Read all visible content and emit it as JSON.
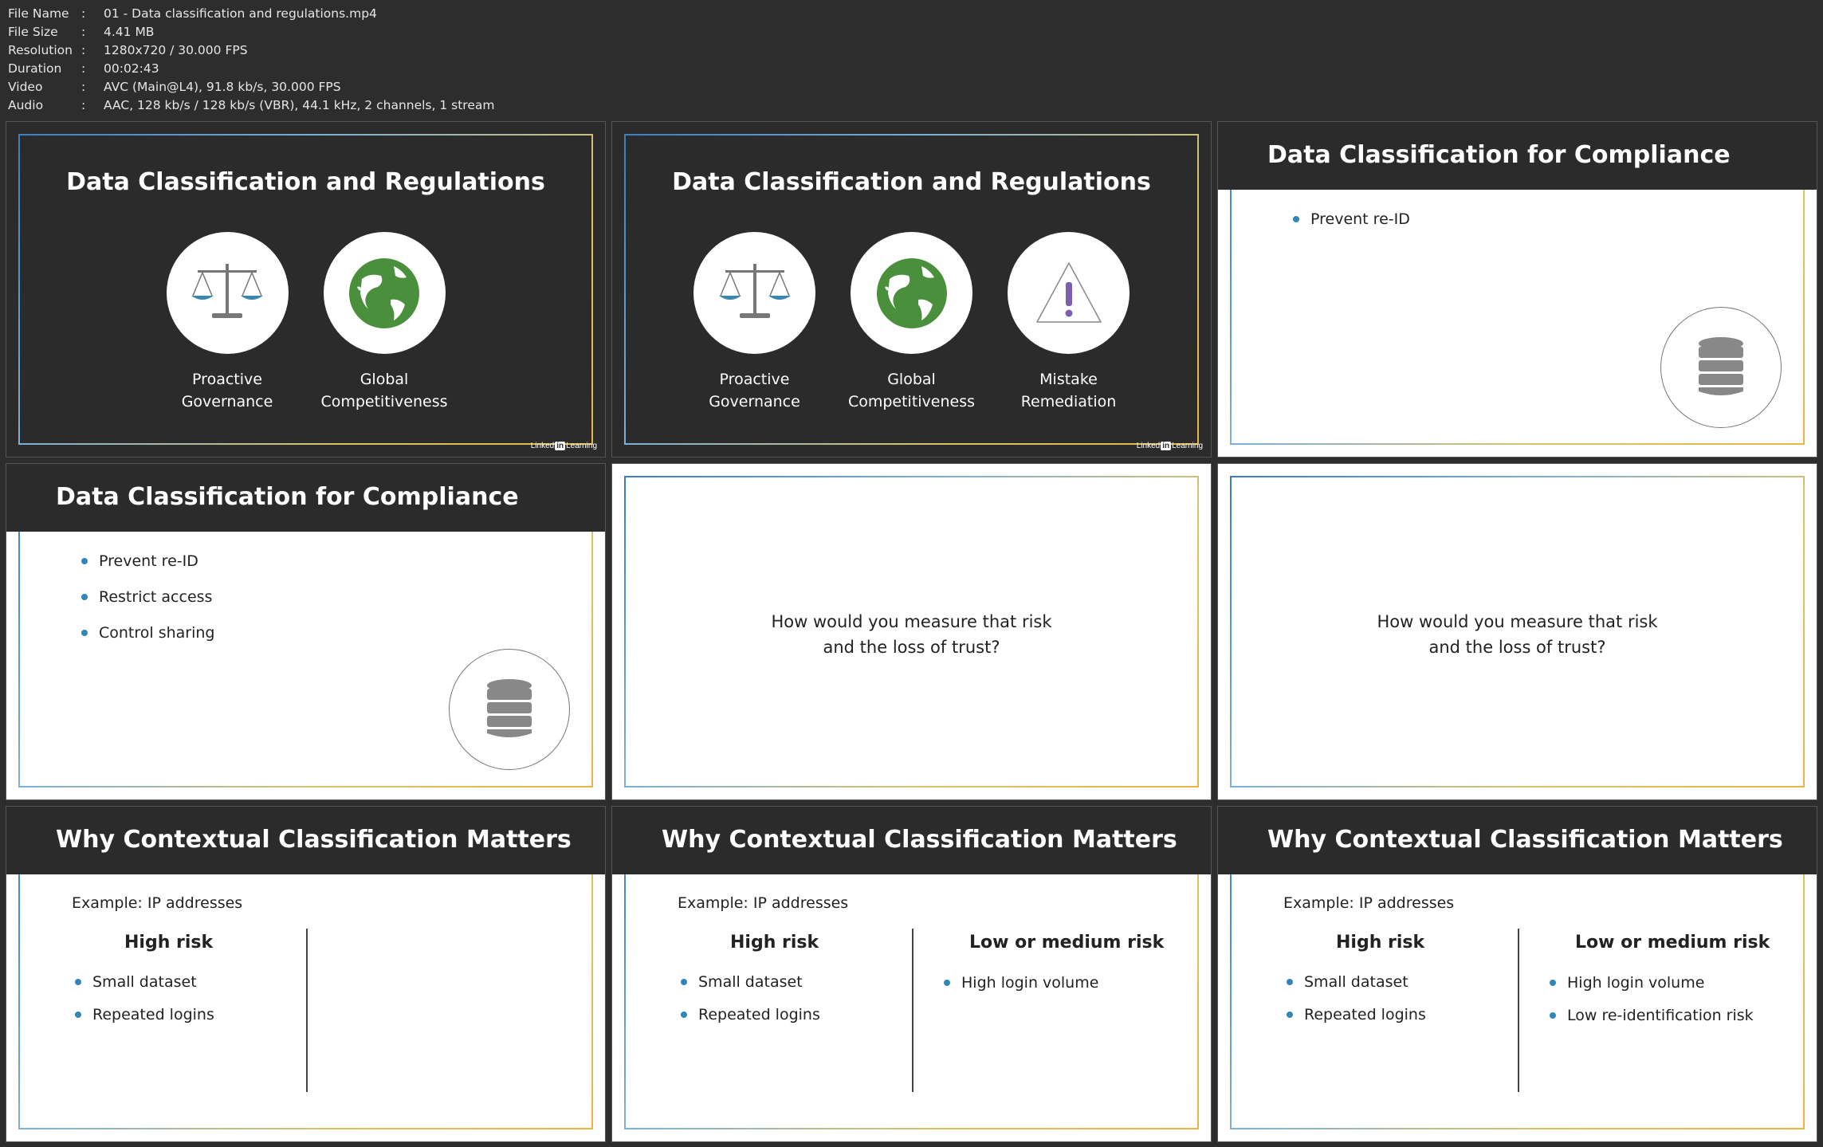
{
  "meta": [
    {
      "key": "File Name",
      "value": "01 - Data classification and regulations.mp4"
    },
    {
      "key": "File Size",
      "value": "4.41 MB"
    },
    {
      "key": "Resolution",
      "value": "1280x720 / 30.000 FPS"
    },
    {
      "key": "Duration",
      "value": "00:02:43"
    },
    {
      "key": "Video",
      "value": "AVC (Main@L4), 91.8 kb/s, 30.000 FPS"
    },
    {
      "key": "Audio",
      "value": "AAC, 128 kb/s / 128 kb/s (VBR), 44.1 kHz, 2 channels, 1 stream"
    }
  ],
  "brand": {
    "pre": "Linked",
    "in": "in",
    "post": "Learning"
  },
  "slide1": {
    "title": "Data Classification and Regulations",
    "labels": [
      "Proactive",
      "Governance",
      "Global",
      "Competitiveness"
    ]
  },
  "slide2": {
    "title": "Data Classification and Regulations",
    "labels": [
      "Proactive",
      "Governance",
      "Global",
      "Competitiveness",
      "Mistake",
      "Remediation"
    ]
  },
  "slide3": {
    "title": "Data Classification for Compliance",
    "bullets": [
      "Prevent re-ID"
    ]
  },
  "slide4": {
    "title": "Data Classification for Compliance",
    "bullets": [
      "Prevent re-ID",
      "Restrict access",
      "Control sharing"
    ]
  },
  "slide5": {
    "lines": [
      "How would you measure that risk",
      "and the loss of trust?"
    ]
  },
  "slide6": {
    "lines": [
      "How would you measure that risk",
      "and the loss of trust?"
    ]
  },
  "slide7": {
    "title": "Why Contextual Classification Matters",
    "example": "Example: IP addresses",
    "high_head": "High risk",
    "high_items": [
      "Small dataset",
      "Repeated logins"
    ]
  },
  "slide8": {
    "title": "Why Contextual Classification Matters",
    "example": "Example: IP addresses",
    "high_head": "High risk",
    "high_items": [
      "Small dataset",
      "Repeated logins"
    ],
    "low_head": "Low or medium risk",
    "low_items": [
      "High login volume"
    ]
  },
  "slide9": {
    "title": "Why Contextual Classification Matters",
    "example": "Example: IP addresses",
    "high_head": "High risk",
    "high_items": [
      "Small dataset",
      "Repeated logins"
    ],
    "low_head": "Low or medium risk",
    "low_items": [
      "High login volume",
      "Low re-identification risk"
    ]
  },
  "colors": {
    "bullet": "#2f87b6",
    "dark_bg": "#2b2b2b",
    "globe_green": "#4a8f3c",
    "warning_purple": "#7b5fb0"
  }
}
